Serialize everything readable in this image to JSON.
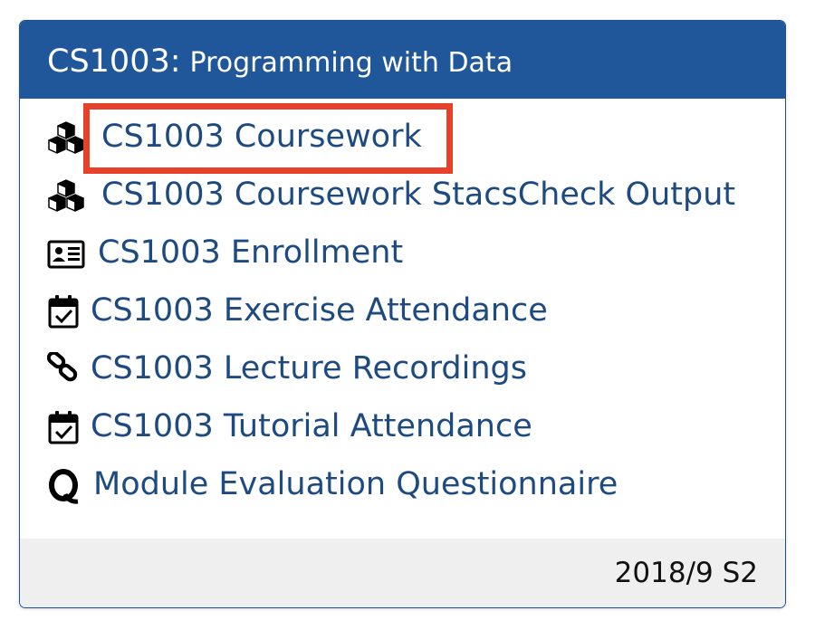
{
  "card": {
    "code": "CS1003",
    "colon": ":",
    "title": "Programming with Data"
  },
  "items": [
    {
      "label": "CS1003 Coursework",
      "icon": "cubes-icon"
    },
    {
      "label": "CS1003 Coursework StacsCheck Output",
      "icon": "cubes-icon"
    },
    {
      "label": "CS1003 Enrollment",
      "icon": "id-card-icon"
    },
    {
      "label": "CS1003 Exercise Attendance",
      "icon": "calendar-check-icon"
    },
    {
      "label": "CS1003 Lecture Recordings",
      "icon": "link-icon"
    },
    {
      "label": "CS1003 Tutorial Attendance",
      "icon": "calendar-check-icon"
    },
    {
      "label": "Module Evaluation Questionnaire",
      "icon": "questionnaire-icon"
    }
  ],
  "footer": {
    "term": "2018/9 S2"
  },
  "colors": {
    "header": "#20569a",
    "link": "#1e4a82",
    "highlight": "#e8412b",
    "footer": "#efefef"
  }
}
